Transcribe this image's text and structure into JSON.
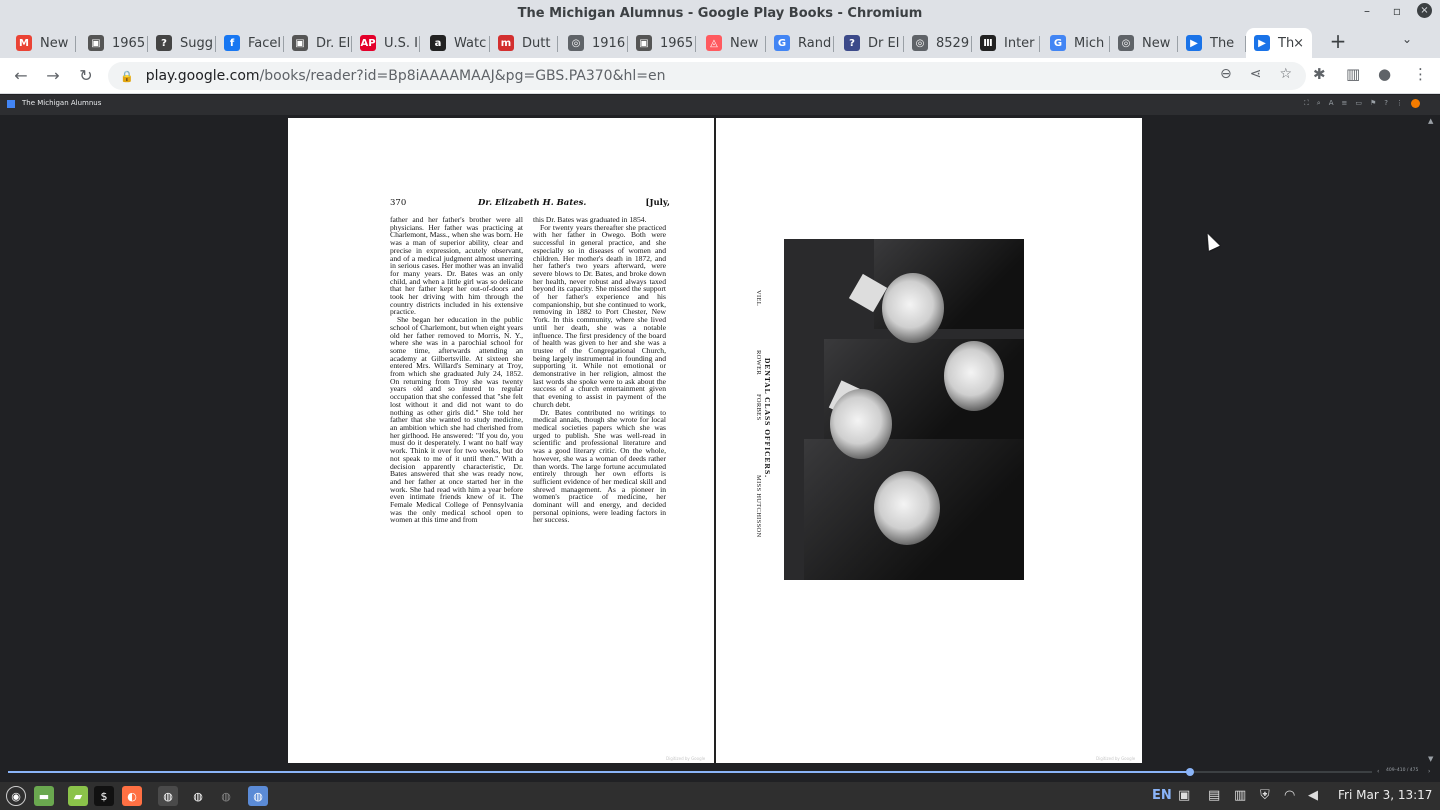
{
  "window": {
    "title": "The Michigan Alumnus - Google Play Books - Chromium",
    "minimize": "–",
    "maximize": "▫",
    "close": "×"
  },
  "tabs": [
    {
      "label": "New",
      "icon": "gmail-icon",
      "color": "#ea4335",
      "glyph": "M"
    },
    {
      "label": "1965",
      "icon": "photo-icon",
      "color": "#555555",
      "glyph": "▣"
    },
    {
      "label": "Sugg",
      "icon": "photo-icon",
      "color": "#444444",
      "glyph": "?"
    },
    {
      "label": "Facel",
      "icon": "facebook-icon",
      "color": "#1877f2",
      "glyph": "f"
    },
    {
      "label": "Dr. El",
      "icon": "photo-icon",
      "color": "#555555",
      "glyph": "▣"
    },
    {
      "label": "U.S. I",
      "icon": "ap-icon",
      "color": "#e4002b",
      "glyph": "AP"
    },
    {
      "label": "Watc",
      "icon": "amazon-icon",
      "color": "#222222",
      "glyph": "a"
    },
    {
      "label": "Dutt",
      "icon": "museum-icon",
      "color": "#d32f2f",
      "glyph": "m"
    },
    {
      "label": "1916",
      "icon": "globe-icon",
      "color": "#5f6368",
      "glyph": "◎"
    },
    {
      "label": "1965",
      "icon": "photo-icon",
      "color": "#555555",
      "glyph": "▣"
    },
    {
      "label": "New",
      "icon": "airbnb-icon",
      "color": "#ff5a5f",
      "glyph": "◬"
    },
    {
      "label": "Rand",
      "icon": "google-icon",
      "color": "#4285f4",
      "glyph": "G"
    },
    {
      "label": "Dr El",
      "icon": "photo-icon",
      "color": "#3c4a8a",
      "glyph": "?"
    },
    {
      "label": "8529",
      "icon": "globe-icon",
      "color": "#5f6368",
      "glyph": "◎"
    },
    {
      "label": "Inter",
      "icon": "archive-icon",
      "color": "#222222",
      "glyph": "Ⅲ"
    },
    {
      "label": "Mich",
      "icon": "google-icon",
      "color": "#4285f4",
      "glyph": "G"
    },
    {
      "label": "New",
      "icon": "globe-icon",
      "color": "#5f6368",
      "glyph": "◎"
    },
    {
      "label": "The",
      "icon": "play-books-icon",
      "color": "#1a73e8",
      "glyph": "▶"
    },
    {
      "label": "Th",
      "icon": "play-books-icon",
      "color": "#1a73e8",
      "glyph": "▶",
      "active": true
    }
  ],
  "toolbar": {
    "url_host": "play.google.com",
    "url_path": "/books/reader?id=Bp8iAAAAMAAJ&pg=GBS.PA370&hl=en",
    "back": "←",
    "forward": "→",
    "reload": "↻",
    "new_tab": "+",
    "tab_search": "⌄"
  },
  "reader": {
    "book_title": "The Michigan Alumnus",
    "page_count": "409–410 / 475"
  },
  "left_page": {
    "number": "370",
    "running_head": "Dr. Elizabeth H. Bates.",
    "month": "[July,",
    "col1": [
      "father and her father's brother were all physicians. Her father was practicing at Charlemont, Mass., when she was born. He was a man of superior ability, clear and precise in expression, acutely observant, and of a medical judgment almost unerring in serious cases. Her mother was an invalid for many years. Dr. Bates was an only child, and when a little girl was so delicate that her father kept her out-of-doors and took her driving with him through the country districts included in his extensive practice.",
      "She began her education in the public school of Charlemont, but when eight years old her father removed to Morris, N. Y., where she was in a parochial school for some time, afterwards attending an academy at Gilbertsville. At sixteen she entered Mrs. Willard's Seminary at Troy, from which she graduated July 24, 1852. On returning from Troy she was twenty years old and so inured to regular occupation that she confessed that \"she felt lost without it and did not want to do nothing as other girls did.\" She told her father that she wanted to study medicine, an ambition which she had cherished from her girlhood. He answered: \"If you do, you must do it desperately. I want no half way work. Think it over for two weeks, but do not speak to me of it until then.\" With a decision apparently characteristic, Dr. Bates answered that she was ready now, and her father at once started her in the work. She had read with him a year before even intimate friends knew of it. The Female Medical College of Pennsylvania was the only medical school open to women at this time and from"
    ],
    "col2": [
      "this Dr. Bates was graduated in 1854.",
      "For twenty years thereafter she practiced with her father in Owego. Both were successful in general practice, and she especially so in diseases of women and children. Her mother's death in 1872, and her father's two years afterward, were severe blows to Dr. Bates, and broke down her health, never robust and always taxed beyond its capacity. She missed the support of her father's experience and his companionship, but she continued to work, removing in 1882 to Port Chester, New York. In this community, where she lived until her death, she was a notable influence. The first presidency of the board of health was given to her and she was a trustee of the Congregational Church, being largely instrumental in founding and supporting it. While not emotional or demonstrative in her religion, almost the last words she spoke were to ask about the success of a church entertainment given that evening to assist in payment of the church debt.",
      "Dr. Bates contributed no writings to medical annals, though she wrote for local medical societies papers which she was urged to publish. She was well-read in scientific and professional literature and was a good literary critic. On the whole, however, she was a woman of deeds rather than words. The large fortune accumulated entirely through her own efforts is sufficient evidence of her medical skill and shrewd management. As a pioneer in women's practice of medicine, her dominant will and energy, and decided personal opinions, were leading factors in her success."
    ],
    "watermark": "Digitized by Google"
  },
  "right_page": {
    "caption": "DENTAL CLASS OFFICERS.",
    "names": [
      "VIEL",
      "ROWER",
      "FORBES",
      "MISS HUTCHISSON"
    ],
    "watermark": "Digitized by Google"
  },
  "taskbar": {
    "lang": "EN",
    "clock": "Fri Mar 3, 13:17"
  },
  "colors": {
    "accent": "#8ab4f8",
    "reader_bg": "#202124",
    "chrome_frame": "#dee1e6"
  }
}
